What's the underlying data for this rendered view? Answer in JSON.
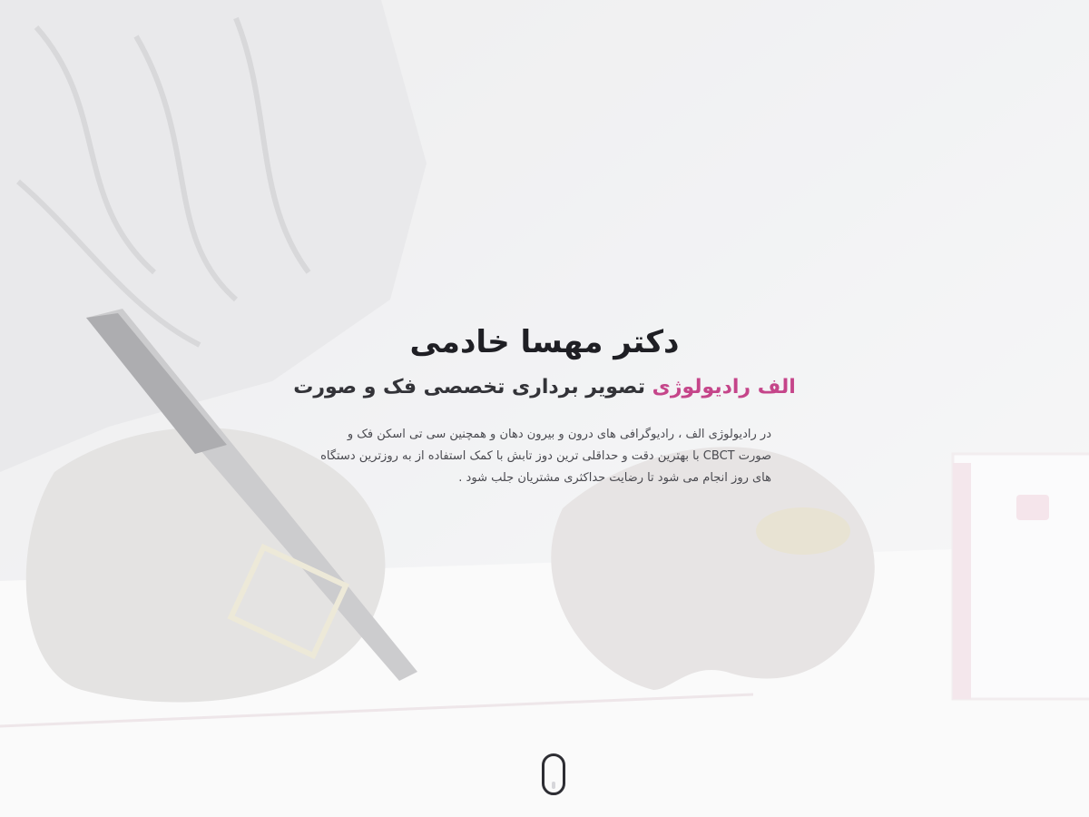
{
  "hero": {
    "title": "دکتر مهسا خادمی",
    "subtitle_accent": "الف رادیولوژی",
    "subtitle_rest": "تصویر برداری تخصصی فک و صورت",
    "description": "در رادیولوژی الف ، رادیوگرافی های درون و بیرون دهان و همچنین سی تی اسکن فک و صورت CBCT با بهترین دقت و حداقلی ترین دوز تابش با کمک استفاده از به روزترین دستگاه های روز انجام می شود تا رضایت حداکثری مشتریان جلب شود ."
  },
  "colors": {
    "accent": "#c5458a",
    "title": "#1f1f24",
    "text": "#4a4a50"
  },
  "scroll_indicator": {
    "icon": "mouse-scroll-icon"
  }
}
